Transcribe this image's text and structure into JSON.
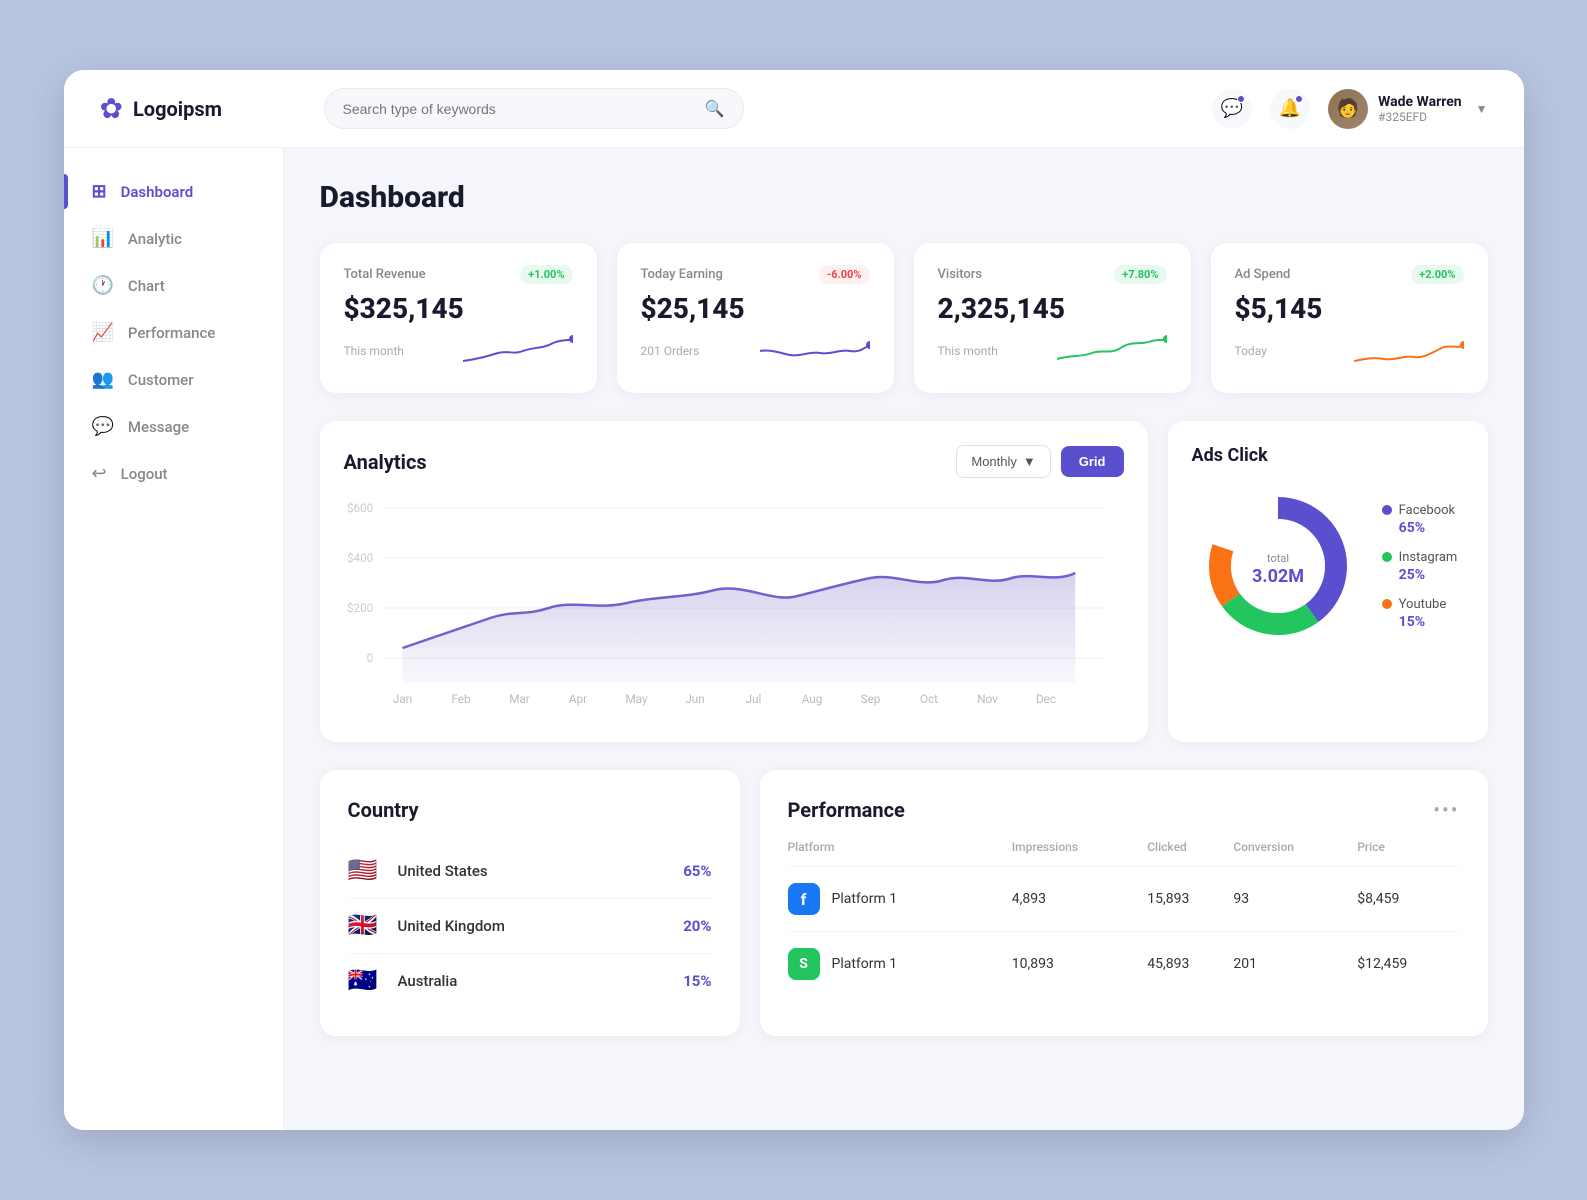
{
  "app": {
    "logo_text": "Logoipsm",
    "logo_icon": "✿"
  },
  "header": {
    "search_placeholder": "Search type of keywords",
    "user": {
      "name": "Wade Warren",
      "id": "#325EFD"
    }
  },
  "sidebar": {
    "items": [
      {
        "id": "dashboard",
        "label": "Dashboard",
        "icon": "⊞",
        "active": true
      },
      {
        "id": "analytic",
        "label": "Analytic",
        "icon": "📊"
      },
      {
        "id": "chart",
        "label": "Chart",
        "icon": "🕐"
      },
      {
        "id": "performance",
        "label": "Performance",
        "icon": "📈"
      },
      {
        "id": "customer",
        "label": "Customer",
        "icon": "👥"
      },
      {
        "id": "message",
        "label": "Message",
        "icon": "💬"
      },
      {
        "id": "logout",
        "label": "Logout",
        "icon": "↩"
      }
    ]
  },
  "page": {
    "title": "Dashboard"
  },
  "stats": [
    {
      "label": "Total Revenue",
      "badge": "+1.00%",
      "badge_type": "green",
      "value": "$325,145",
      "sub": "This month",
      "chart_color": "#5a4fcf",
      "chart_dot": "#5a4fcf"
    },
    {
      "label": "Today Earning",
      "badge": "-6.00%",
      "badge_type": "red",
      "value": "$25,145",
      "sub": "201 Orders",
      "chart_color": "#5a4fcf",
      "chart_dot": "#5a4fcf"
    },
    {
      "label": "Visitors",
      "badge": "+7.80%",
      "badge_type": "green",
      "value": "2,325,145",
      "sub": "This month",
      "chart_color": "#22c55e",
      "chart_dot": "#22c55e"
    },
    {
      "label": "Ad Spend",
      "badge": "+2.00%",
      "badge_type": "green",
      "value": "$5,145",
      "sub": "Today",
      "chart_color": "#f97316",
      "chart_dot": "#f97316"
    }
  ],
  "analytics": {
    "title": "Analytics",
    "dropdown_label": "Monthly",
    "grid_label": "Grid",
    "x_labels": [
      "Jan",
      "Feb",
      "Mar",
      "Apr",
      "May",
      "Jun",
      "Jul",
      "Aug",
      "Sep",
      "Oct",
      "Nov",
      "Dec"
    ],
    "y_labels": [
      "$600",
      "$400",
      "$200",
      "0"
    ]
  },
  "ads_click": {
    "title": "Ads Click",
    "total_label": "total",
    "total_value": "3.02M",
    "legend": [
      {
        "name": "Facebook",
        "pct": "65%",
        "color": "#5a4fcf"
      },
      {
        "name": "Instagram",
        "pct": "25%",
        "color": "#22c55e"
      },
      {
        "name": "Youtube",
        "pct": "15%",
        "color": "#f97316"
      }
    ]
  },
  "country": {
    "title": "Country",
    "items": [
      {
        "name": "United States",
        "flag": "🇺🇸",
        "pct": "65%"
      },
      {
        "name": "United Kingdom",
        "flag": "🇬🇧",
        "pct": "20%"
      },
      {
        "name": "Australia",
        "flag": "🇦🇺",
        "pct": "15%"
      }
    ]
  },
  "performance": {
    "title": "Performance",
    "columns": [
      "Platform",
      "Impressions",
      "Clicked",
      "Conversion",
      "Price"
    ],
    "rows": [
      {
        "platform": "Platform 1",
        "icon": "fb",
        "impressions": "4,893",
        "clicked": "15,893",
        "conversion": "93",
        "price": "$8,459"
      },
      {
        "platform": "Platform 1",
        "icon": "ig",
        "impressions": "10,893",
        "clicked": "45,893",
        "conversion": "201",
        "price": "$12,459"
      }
    ]
  }
}
